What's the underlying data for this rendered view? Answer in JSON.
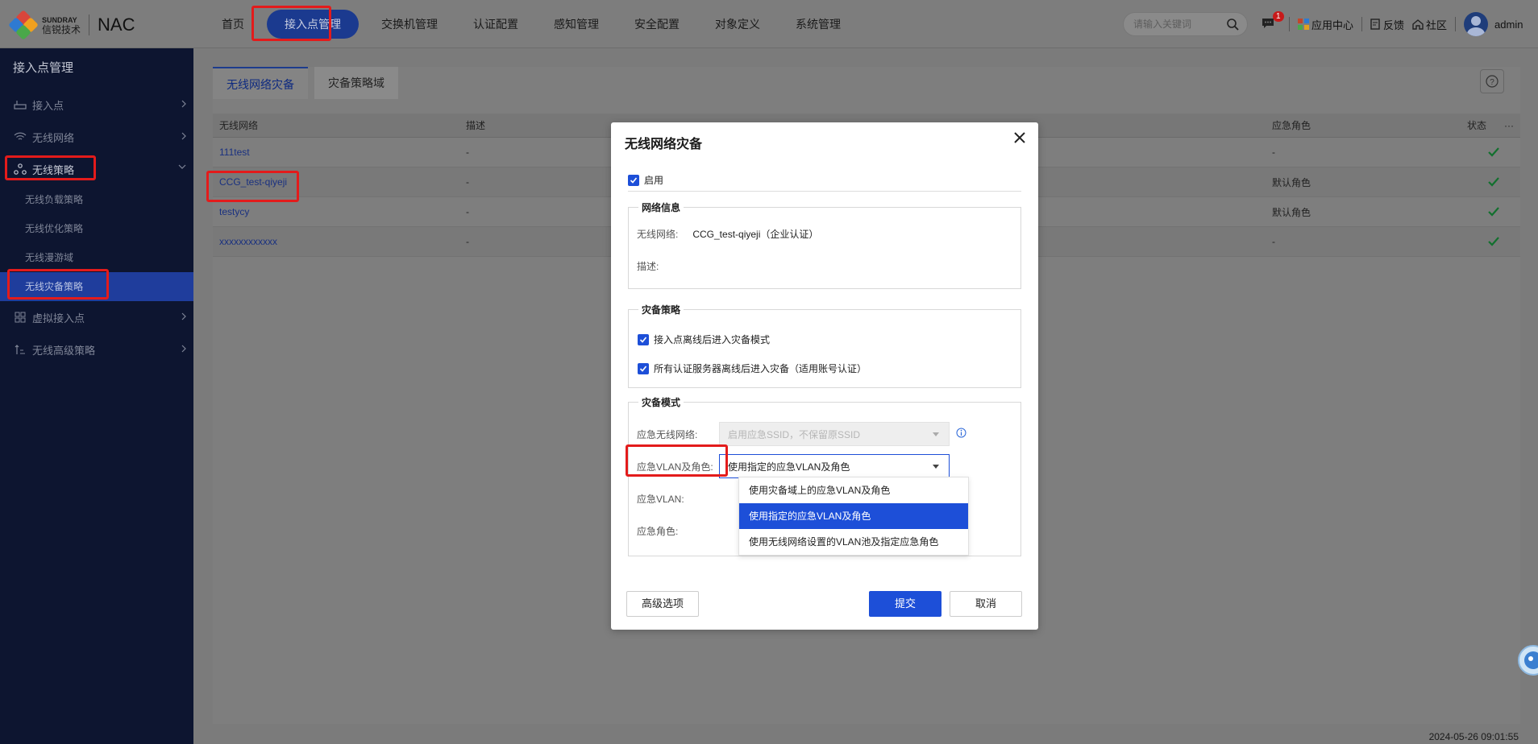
{
  "brand": {
    "en": "SUNDRAY",
    "cn": "信锐技术",
    "product": "NAC"
  },
  "nav": [
    "首页",
    "接入点管理",
    "交换机管理",
    "认证配置",
    "感知管理",
    "安全配置",
    "对象定义",
    "系统管理"
  ],
  "search": {
    "placeholder": "请输入关键词"
  },
  "top_right": {
    "badge_count": "1",
    "app_center": "应用中心",
    "feedback": "反馈",
    "community": "社区",
    "user": "admin"
  },
  "sidebar": {
    "title": "接入点管理",
    "items": [
      "接入点",
      "无线网络",
      "无线策略",
      "无线负载策略",
      "无线优化策略",
      "无线漫游域",
      "无线灾备策略",
      "虚拟接入点",
      "无线高级策略"
    ]
  },
  "tabs": [
    "无线网络灾备",
    "灾备策略域"
  ],
  "table": {
    "headers": [
      "无线网络",
      "描述",
      "应急角色",
      "状态"
    ],
    "rows": [
      {
        "network": "111test",
        "desc": "-",
        "role": "-"
      },
      {
        "network": "CCG_test-qiyeji",
        "desc": "-",
        "role": "默认角色"
      },
      {
        "network": "testycy",
        "desc": "-",
        "role": "默认角色"
      },
      {
        "network": "xxxxxxxxxxxx",
        "desc": "-",
        "role": "-"
      }
    ],
    "more": "···"
  },
  "timestamp": "2024-05-26 09:01:55",
  "modal": {
    "title": "无线网络灾备",
    "enable_label": "启用",
    "network_info": {
      "legend": "网络信息",
      "network_label": "无线网络:",
      "network_value": "CCG_test-qiyeji（企业认证）",
      "desc_label": "描述:"
    },
    "policy": {
      "legend": "灾备策略",
      "opt1": "接入点离线后进入灾备模式",
      "opt2": "所有认证服务器离线后进入灾备（适用账号认证）"
    },
    "mode": {
      "legend": "灾备模式",
      "ssid_label": "应急无线网络:",
      "ssid_value": "启用应急SSID，不保留原SSID",
      "vlan_role_label": "应急VLAN及角色:",
      "vlan_role_value": "使用指定的应急VLAN及角色",
      "vlan_label": "应急VLAN:",
      "role_label": "应急角色:"
    },
    "dropdown_options": [
      "使用灾备域上的应急VLAN及角色",
      "使用指定的应急VLAN及角色",
      "使用无线网络设置的VLAN池及指定应急角色"
    ],
    "buttons": {
      "advanced": "高级选项",
      "submit": "提交",
      "cancel": "取消"
    }
  },
  "colors": {
    "accent": "#1d4fd8",
    "highlight": "#e31b1b",
    "sidebar_bg": "#0d1530",
    "success": "#1a8a3a"
  }
}
